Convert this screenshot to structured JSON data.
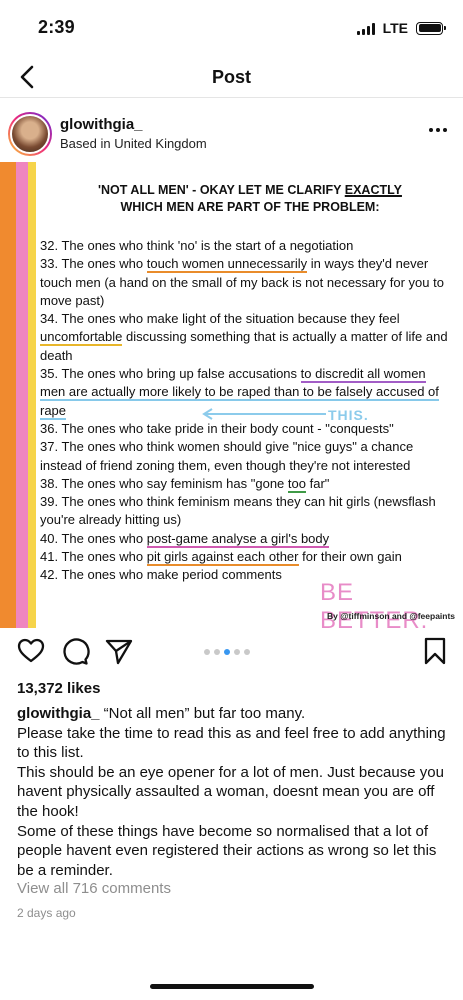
{
  "status": {
    "time": "2:39",
    "network": "LTE",
    "battery_icon": "battery-icon"
  },
  "nav": {
    "title": "Post"
  },
  "header": {
    "username": "glowithgia_",
    "location": "Based in United Kingdom"
  },
  "post_image": {
    "heading_line1": "'NOT ALL MEN' - OKAY LET ME CLARIFY ",
    "heading_exactly": "EXACTLY",
    "heading_line2": "WHICH MEN ARE PART OF THE PROBLEM:",
    "items": {
      "i32": "32. The ones who think 'no' is the start of a negotiation",
      "i33a": "33. The ones who ",
      "i33b": "touch women unnecessarily",
      "i33c": " in ways they'd never touch men (a hand on the small of my back is not necessary for you to move past)",
      "i34a": "34. The ones who make light of the situation because they feel ",
      "i34b": "uncomfortable",
      "i34c": " discussing something that is actually a matter of life and death",
      "i35a": "35. The ones who bring up false accusations ",
      "i35b": "to discredit all women",
      "i35c": " ",
      "i35d": "men are actually more likely to be raped than to be falsely accused of rape",
      "i36a": "36. The ones who take pride in their body count - ",
      "i36b": "\"conquests\"",
      "i37": "37. The ones who think women should give \"nice guys\" a chance instead of friend zoning them, even though they're not interested",
      "i38a": "38. The ones who say feminism has \"gone ",
      "i38b": "too",
      "i38c": " far\"",
      "i39": "39. The ones who think feminism means they can hit girls (newsflash you're already hitting us)",
      "i40a": "40. The ones who ",
      "i40b": "post-game analyse a girl's body",
      "i41a": "41. The ones who ",
      "i41b": "pit girls against each other",
      "i41c": " for their own gain",
      "i42": "42. The ones who make period comments"
    },
    "note_this": "THIS.",
    "be_better": "BE BETTER.",
    "credit": "By @tiffminson and @feepaints"
  },
  "actions": {
    "like_icon": "heart-icon",
    "comment_icon": "comment-icon",
    "share_icon": "paper-plane-icon",
    "save_icon": "bookmark-icon",
    "carousel_count": 5,
    "carousel_active": 3
  },
  "likes": "13,372 likes",
  "caption": {
    "username": "glowithgia_",
    "line1": " “Not all men” but far too many.",
    "line2": "Please take the time to read this as and feel free to add anything to this list.",
    "line3": "This should be an eye opener for a lot of men. Just because you havent physically assaulted a woman, doesnt mean you are off the hook!",
    "line4": "Some of these things have become so normalised that a lot of people havent even registered their actions as wrong so let this be a reminder."
  },
  "comments_link": "View all 716 comments",
  "time_ago": "2 days ago",
  "colors": {
    "accent": "#3897f0",
    "stripe_orange": "#f08a2f",
    "stripe_pink": "#ef86bf",
    "stripe_yellow": "#f6d44a"
  }
}
